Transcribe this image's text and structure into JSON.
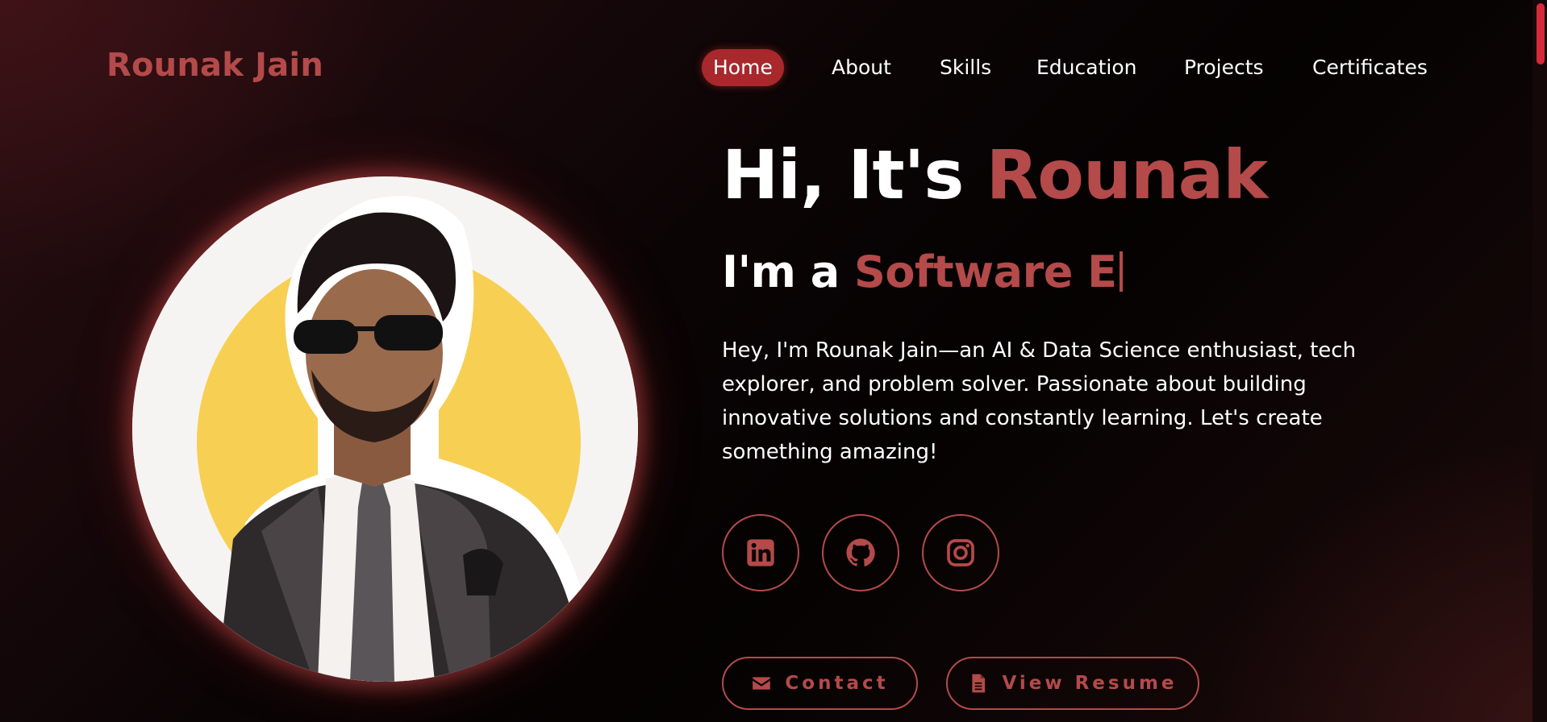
{
  "header": {
    "logo": "Rounak Jain",
    "nav": [
      {
        "label": "Home",
        "active": true
      },
      {
        "label": "About",
        "active": false
      },
      {
        "label": "Skills",
        "active": false
      },
      {
        "label": "Education",
        "active": false
      },
      {
        "label": "Projects",
        "active": false
      },
      {
        "label": "Certificates",
        "active": false
      }
    ]
  },
  "hero": {
    "greeting": "Hi, It's ",
    "name": "Rounak",
    "role_prefix": "I'm a",
    "role_typed": "Software E",
    "bio": "Hey, I'm Rounak Jain—an AI & Data Science enthusiast, tech explorer, and problem solver. Passionate about building innovative solutions and constantly learning. Let's create something amazing!"
  },
  "socials": [
    {
      "icon": "linkedin-icon"
    },
    {
      "icon": "github-icon"
    },
    {
      "icon": "instagram-icon"
    }
  ],
  "buttons": {
    "contact_label": "Contact",
    "contact_icon": "envelope-icon",
    "resume_label": "View Resume",
    "resume_icon": "document-icon"
  },
  "colors": {
    "accent": "#b44a4a",
    "active_nav": "#a8282c",
    "text": "#ffffff",
    "background": "#0a0405"
  }
}
